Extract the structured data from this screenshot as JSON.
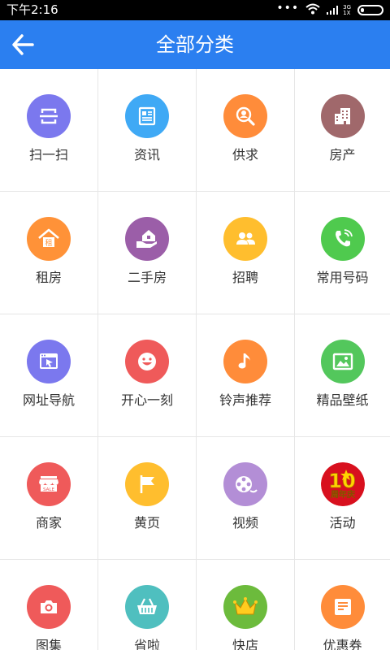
{
  "status": {
    "time": "下午2:16",
    "network_top": "3G",
    "network_bottom": "1X"
  },
  "header": {
    "title": "全部分类"
  },
  "colors": {
    "header": "#2b7ff0",
    "status_bar": "#000000"
  },
  "categories": [
    {
      "label": "扫一扫",
      "icon": "scan-icon",
      "color": "#7b78ee"
    },
    {
      "label": "资讯",
      "icon": "news-icon",
      "color": "#3fa9f5"
    },
    {
      "label": "供求",
      "icon": "search-person-icon",
      "color": "#ff8c3a"
    },
    {
      "label": "房产",
      "icon": "building-icon",
      "color": "#a0686b"
    },
    {
      "label": "租房",
      "icon": "rent-house-icon",
      "color": "#ff9238"
    },
    {
      "label": "二手房",
      "icon": "hand-house-icon",
      "color": "#9b5ea8"
    },
    {
      "label": "招聘",
      "icon": "people-icon",
      "color": "#ffbe2e"
    },
    {
      "label": "常用号码",
      "icon": "phone-icon",
      "color": "#4fca4e"
    },
    {
      "label": "网址导航",
      "icon": "browser-icon",
      "color": "#7b78ee"
    },
    {
      "label": "开心一刻",
      "icon": "smile-icon",
      "color": "#ef5a5a"
    },
    {
      "label": "铃声推荐",
      "icon": "music-note-icon",
      "color": "#ff8c3a"
    },
    {
      "label": "精品壁纸",
      "icon": "picture-icon",
      "color": "#53c75c"
    },
    {
      "label": "商家",
      "icon": "shop-icon",
      "color": "#ef5a5a"
    },
    {
      "label": "黄页",
      "icon": "flag-icon",
      "color": "#ffbe2e"
    },
    {
      "label": "视频",
      "icon": "film-reel-icon",
      "color": "#b38ed6"
    },
    {
      "label": "活动",
      "icon": "anniversary-badge-icon",
      "color": "#d8101e",
      "badge_text": "10周年庆"
    },
    {
      "label": "图集",
      "icon": "camera-icon",
      "color": "#ef5a5a"
    },
    {
      "label": "省啦",
      "icon": "basket-icon",
      "color": "#4fbfbf"
    },
    {
      "label": "快店",
      "icon": "crown-icon",
      "color": "#6cbb3c"
    },
    {
      "label": "优惠券",
      "icon": "coupon-icon",
      "color": "#ff8c3a"
    }
  ]
}
